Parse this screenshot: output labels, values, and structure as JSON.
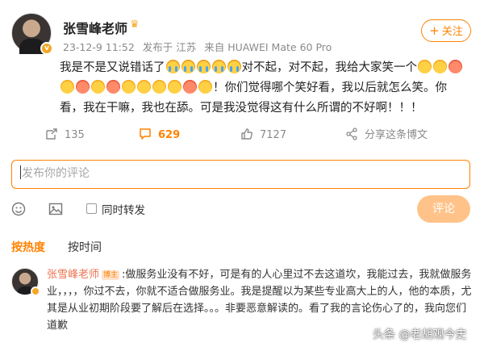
{
  "post": {
    "author": "张雪峰老师",
    "meta": {
      "time": "23-12-9 11:52",
      "location": "发布于 江苏",
      "device": "来自 HUAWEI Mate 60 Pro"
    },
    "follow_label": "关注",
    "text": {
      "seg1": "我是不是又说错话了",
      "seg2": "对不起，对不起，我给大家笑一个",
      "seg3": "！你们觉得哪个笑好看，我以后就怎么笑。你看，我在干嘛，我也在舔。可是我没觉得这有什么所谓的不好啊！！！"
    },
    "actions": {
      "forward_count": "135",
      "comment_count": "629",
      "like_count": "7127",
      "share_label": "分享这条博文"
    }
  },
  "comment_box": {
    "placeholder": "发布你的评论",
    "repost_label": "同时转发",
    "submit_label": "评论"
  },
  "sort_tabs": {
    "hot": "按热度",
    "time": "按时间"
  },
  "comments": [
    {
      "author": "张雪峰老师",
      "tag": "博主",
      "text": ":做服务业没有不好，可是有的人心里过不去这道坎，我能过去，我就做服务业，，，，你过不去，你就不适合做服务业。我是提醒以为某些专业高大上的人，他的本质，尤其是从业初期阶段要了解后在选择。。。非要恶意解读的。看了我的言论伤心了的，我向您们道歉"
    }
  ],
  "watermark": "头条 @老胡观今史",
  "colors": {
    "accent": "#ff8200",
    "commenter": "#eb7350",
    "submit_disabled": "#ffc38a"
  },
  "icons": [
    "crown-icon",
    "forward-icon",
    "comment-icon",
    "like-icon",
    "share-icon",
    "emoji-icon",
    "image-icon"
  ]
}
